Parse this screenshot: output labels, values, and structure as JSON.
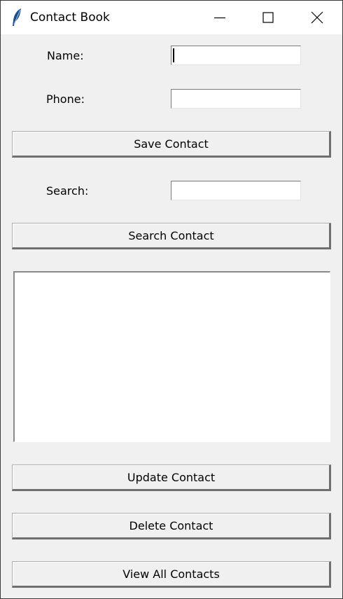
{
  "window": {
    "title": "Contact Book",
    "icon": "feather-icon",
    "controls": [
      "minimize-icon",
      "maximize-icon",
      "close-icon"
    ]
  },
  "form": {
    "name_label": "Name:",
    "name_value": "",
    "phone_label": "Phone:",
    "phone_value": "",
    "save_button": "Save Contact",
    "search_label": "Search:",
    "search_value": "",
    "search_button": "Search Contact"
  },
  "contacts_list": {
    "items": []
  },
  "actions": {
    "update_button": "Update Contact",
    "delete_button": "Delete Contact",
    "view_all_button": "View All Contacts"
  }
}
